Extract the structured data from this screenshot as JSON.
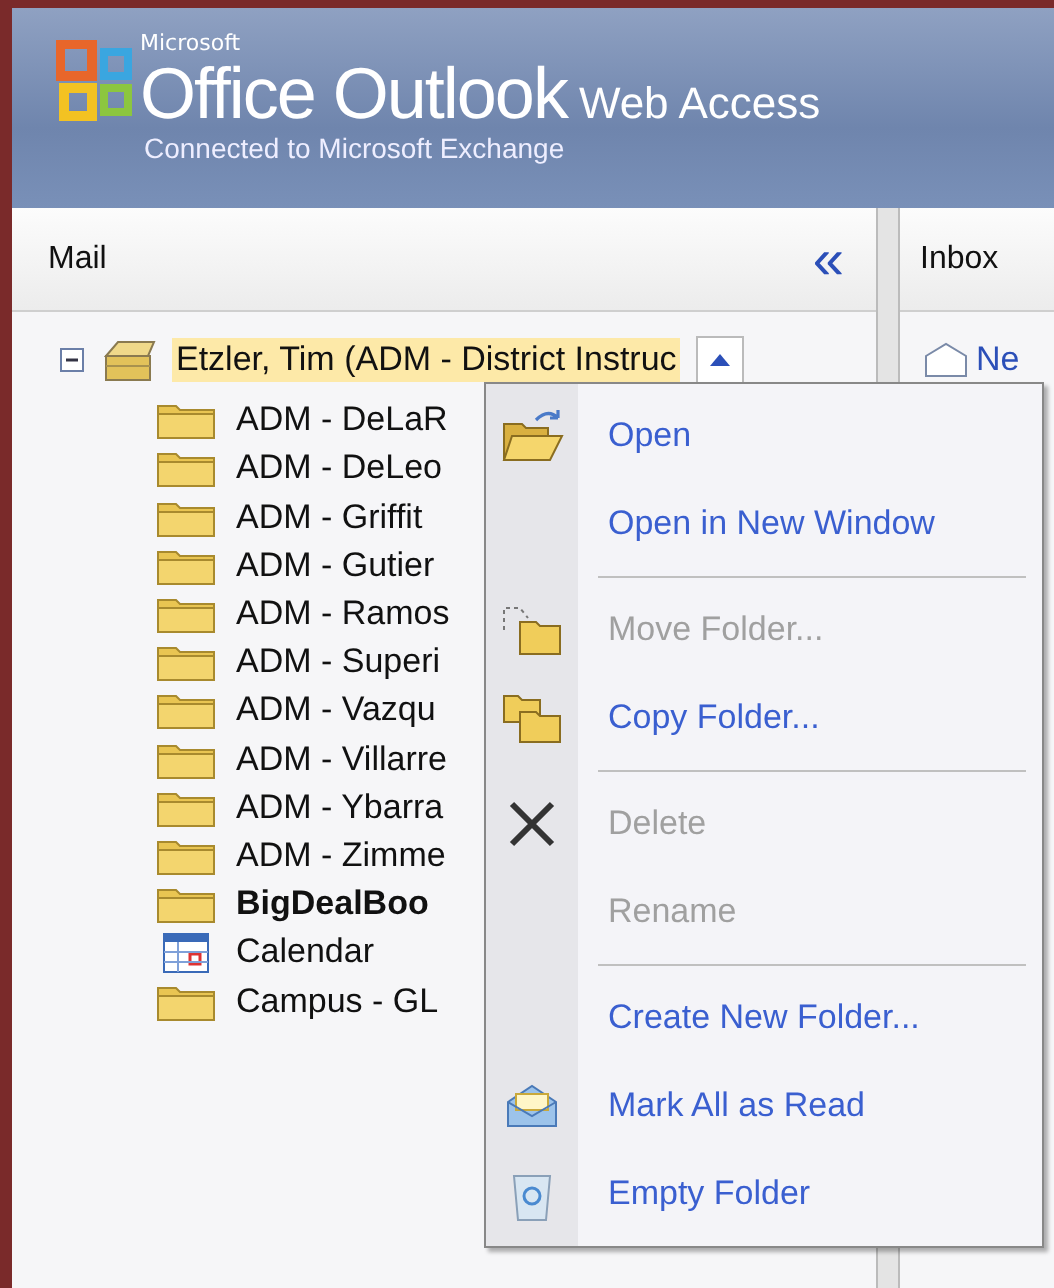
{
  "header": {
    "brand_small": "Microsoft",
    "product": "Office Outlook",
    "product_suffix": "Web Access",
    "subtitle": "Connected to Microsoft Exchange"
  },
  "mail_pane": {
    "title": "Mail",
    "collapse_glyph": "«"
  },
  "folder_tree": {
    "label": "Etzler, Tim (ADM - District Instruc",
    "kind": "mailbox",
    "expanded": true,
    "selected": true,
    "children": [
      {
        "label": "ADM - DeLaR",
        "kind": "folder",
        "bold": false
      },
      {
        "label": "ADM - DeLeo",
        "kind": "folder",
        "bold": false
      },
      {
        "label": "ADM - Griffit",
        "kind": "folder",
        "bold": false
      },
      {
        "label": "ADM - Gutier",
        "kind": "folder",
        "bold": false
      },
      {
        "label": "ADM - Ramos",
        "kind": "folder",
        "bold": false
      },
      {
        "label": "ADM - Superi",
        "kind": "folder",
        "bold": false
      },
      {
        "label": "ADM - Vazqu",
        "kind": "folder",
        "bold": false
      },
      {
        "label": "ADM - Villarre",
        "kind": "folder",
        "bold": false
      },
      {
        "label": "ADM - Ybarra",
        "kind": "folder",
        "bold": false
      },
      {
        "label": "ADM - Zimme",
        "kind": "folder",
        "bold": false
      },
      {
        "label": "BigDealBoo",
        "kind": "folder",
        "bold": true
      },
      {
        "label": "Calendar",
        "kind": "calendar",
        "bold": false
      },
      {
        "label": "Campus - GL",
        "kind": "folder",
        "bold": false
      }
    ]
  },
  "inbox_pane": {
    "title": "Inbox",
    "new_link": "Ne"
  },
  "context_menu": [
    {
      "kind": "open",
      "label": "Open",
      "disabled": false
    },
    {
      "kind": "text",
      "label": "Open in New Window",
      "disabled": false
    },
    {
      "kind": "separator"
    },
    {
      "kind": "move",
      "label": "Move Folder...",
      "disabled": true
    },
    {
      "kind": "copy",
      "label": "Copy Folder...",
      "disabled": false
    },
    {
      "kind": "separator"
    },
    {
      "kind": "delete",
      "label": "Delete",
      "disabled": true
    },
    {
      "kind": "text",
      "label": "Rename",
      "disabled": true
    },
    {
      "kind": "separator"
    },
    {
      "kind": "text",
      "label": "Create New Folder...",
      "disabled": false
    },
    {
      "kind": "mark",
      "label": "Mark All as Read",
      "disabled": false
    },
    {
      "kind": "empty",
      "label": "Empty Folder",
      "disabled": false
    }
  ]
}
